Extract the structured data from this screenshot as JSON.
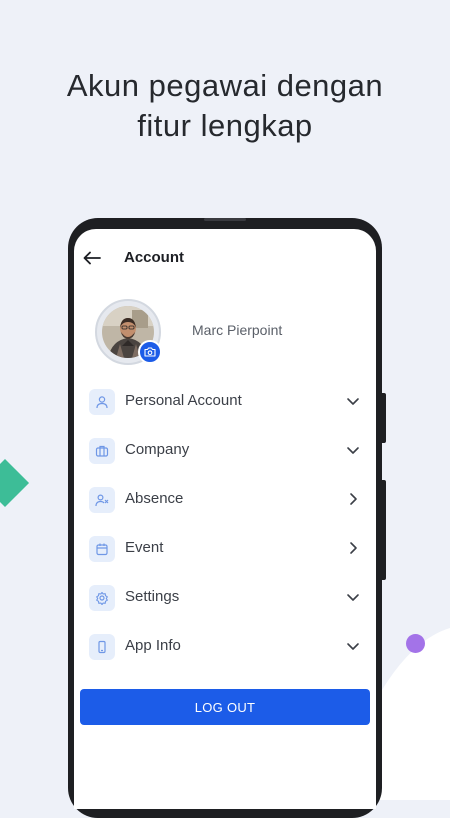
{
  "headline": {
    "line1": "Akun pegawai dengan",
    "line2": "fitur lengkap"
  },
  "colors": {
    "background": "#eef1f8",
    "accent": "#1c5ce8",
    "diamond": "#3dbd97",
    "dot": "#a373e8",
    "icon_tile": "#e6eefb"
  },
  "appbar": {
    "back_icon": "arrow-left-icon",
    "title": "Account"
  },
  "profile": {
    "name": "Marc Pierpoint",
    "camera_icon": "camera-icon"
  },
  "menu": [
    {
      "label": "Personal Account",
      "icon": "user-icon",
      "chevron": "chevron-down-icon"
    },
    {
      "label": "Company",
      "icon": "briefcase-icon",
      "chevron": "chevron-down-icon"
    },
    {
      "label": "Absence",
      "icon": "user-x-icon",
      "chevron": "chevron-right-icon"
    },
    {
      "label": "Event",
      "icon": "calendar-icon",
      "chevron": "chevron-right-icon"
    },
    {
      "label": "Settings",
      "icon": "gear-icon",
      "chevron": "chevron-down-icon"
    },
    {
      "label": "App Info",
      "icon": "phone-icon",
      "chevron": "chevron-down-icon"
    }
  ],
  "logout": {
    "label": "LOG OUT"
  }
}
